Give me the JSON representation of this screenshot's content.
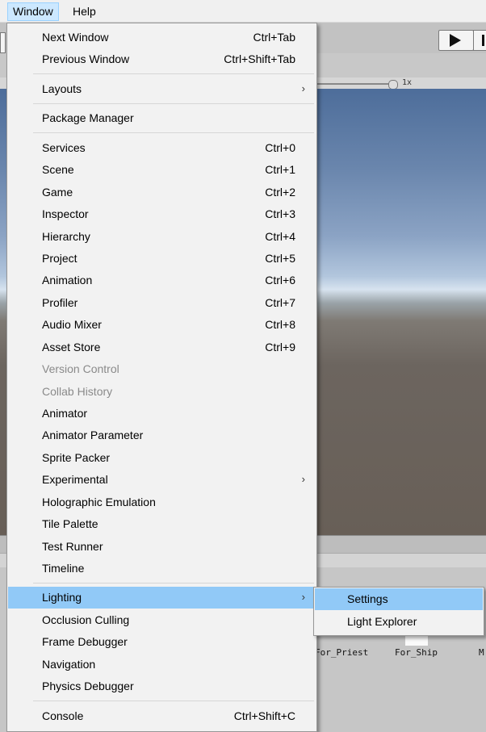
{
  "menubar": {
    "items": [
      {
        "label": "Window"
      },
      {
        "label": "Help"
      }
    ]
  },
  "background": {
    "scale_label": "1x",
    "assets": [
      "For_Priest",
      "For_Ship",
      "M"
    ]
  },
  "window_menu": {
    "items": [
      {
        "label": "Next Window",
        "shortcut": "Ctrl+Tab"
      },
      {
        "label": "Previous Window",
        "shortcut": "Ctrl+Shift+Tab"
      },
      {
        "label": "Layouts",
        "submenu": "›"
      },
      {
        "label": "Package Manager"
      },
      {
        "label": "Services",
        "shortcut": "Ctrl+0"
      },
      {
        "label": "Scene",
        "shortcut": "Ctrl+1"
      },
      {
        "label": "Game",
        "shortcut": "Ctrl+2"
      },
      {
        "label": "Inspector",
        "shortcut": "Ctrl+3"
      },
      {
        "label": "Hierarchy",
        "shortcut": "Ctrl+4"
      },
      {
        "label": "Project",
        "shortcut": "Ctrl+5"
      },
      {
        "label": "Animation",
        "shortcut": "Ctrl+6"
      },
      {
        "label": "Profiler",
        "shortcut": "Ctrl+7"
      },
      {
        "label": "Audio Mixer",
        "shortcut": "Ctrl+8"
      },
      {
        "label": "Asset Store",
        "shortcut": "Ctrl+9"
      },
      {
        "label": "Version Control",
        "disabled": true
      },
      {
        "label": "Collab History",
        "disabled": true
      },
      {
        "label": "Animator"
      },
      {
        "label": "Animator Parameter"
      },
      {
        "label": "Sprite Packer"
      },
      {
        "label": "Experimental",
        "submenu": "›"
      },
      {
        "label": "Holographic Emulation"
      },
      {
        "label": "Tile Palette"
      },
      {
        "label": "Test Runner"
      },
      {
        "label": "Timeline"
      },
      {
        "label": "Lighting",
        "submenu": "›",
        "highlighted": true
      },
      {
        "label": "Occlusion Culling"
      },
      {
        "label": "Frame Debugger"
      },
      {
        "label": "Navigation"
      },
      {
        "label": "Physics Debugger"
      },
      {
        "label": "Console",
        "shortcut": "Ctrl+Shift+C"
      }
    ]
  },
  "lighting_submenu": {
    "items": [
      {
        "label": "Settings",
        "highlighted": true
      },
      {
        "label": "Light Explorer"
      }
    ]
  },
  "colors": {
    "menu_highlight": "#91c9f7",
    "active_menu_bg": "#cce8ff",
    "disabled_text": "#8a8a8a"
  }
}
